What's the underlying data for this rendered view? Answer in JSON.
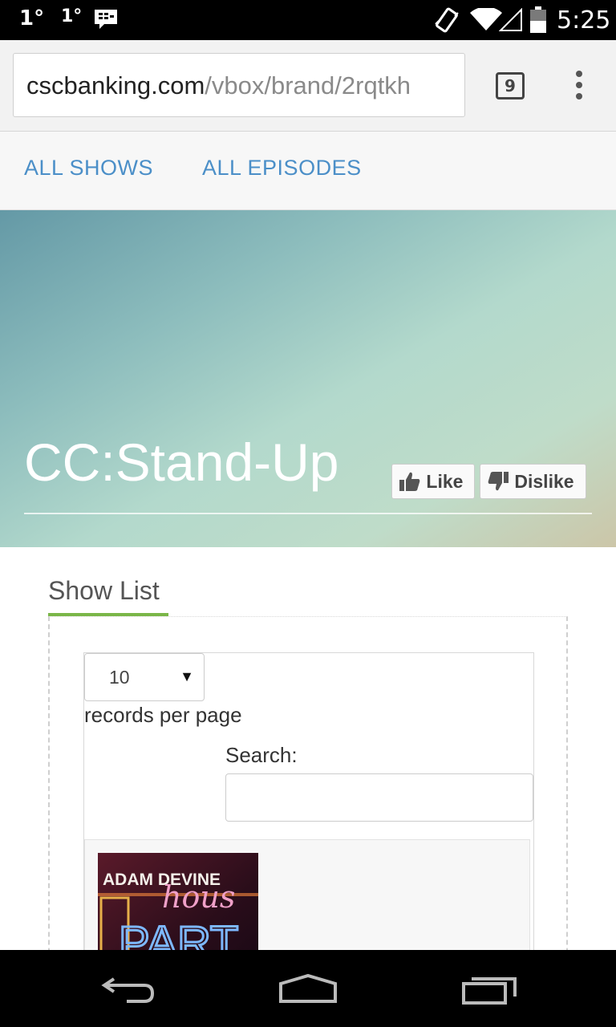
{
  "status_bar": {
    "temp1": "1°",
    "temp2": "1°",
    "time": "5:25"
  },
  "browser": {
    "url_domain": "cscbanking.com",
    "url_path": "/vbox/brand/2rqtkh",
    "tab_count": "9"
  },
  "site_nav": {
    "items": [
      "ALL SHOWS",
      "ALL EPISODES"
    ]
  },
  "hero": {
    "title": "CC:Stand-Up",
    "like_label": "Like",
    "dislike_label": "Dislike"
  },
  "show_list": {
    "tab_label": "Show List",
    "page_length": "10",
    "records_label": "records per page",
    "search_label": "Search:",
    "search_value": "",
    "thumb_text": {
      "line1": "ADAM DEVINE",
      "line2": "hous",
      "line3": "PART"
    }
  },
  "colors": {
    "link": "#4b8fc8",
    "tab_accent": "#7ab648"
  }
}
